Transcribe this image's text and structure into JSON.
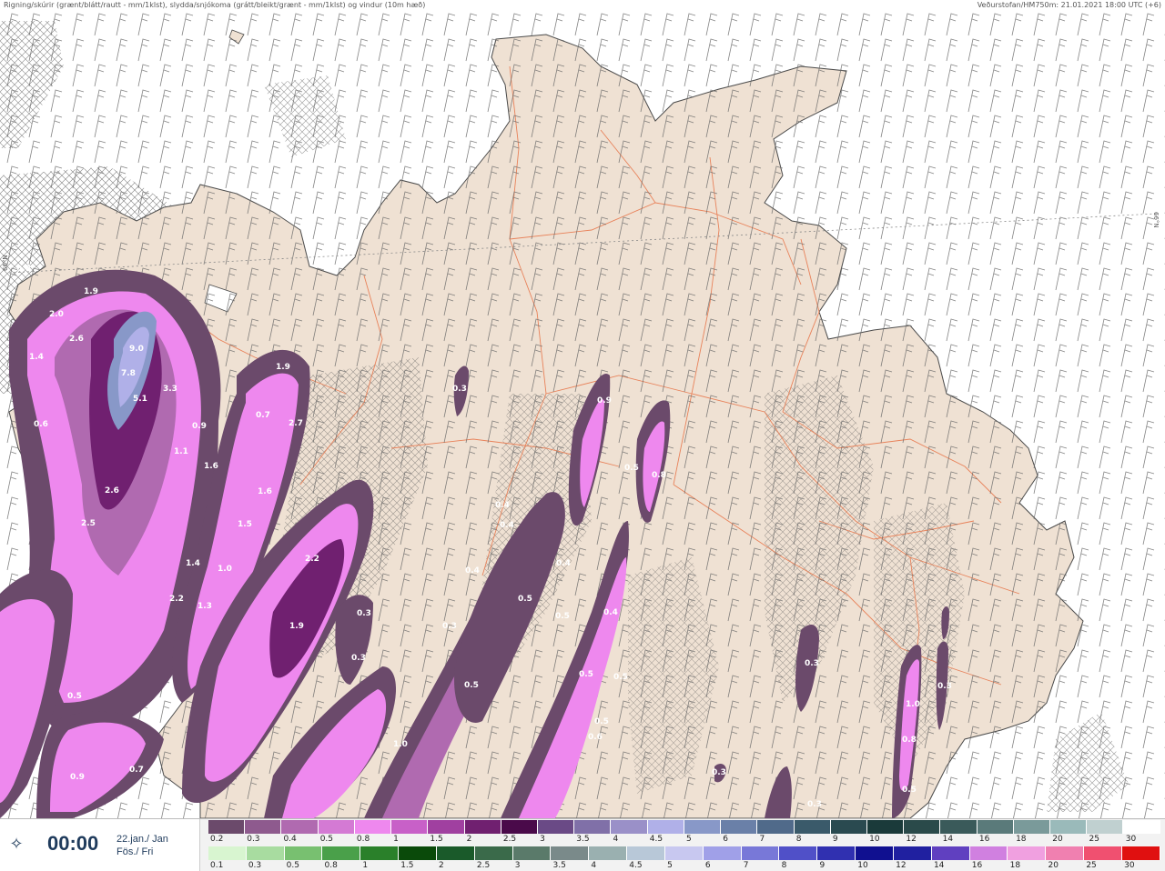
{
  "header": {
    "title": "Rigning/skúrir (grænt/blátt/rautt - mm/1klst), slydda/snjókoma (grátt/bleikt/grænt - mm/1klst) og vindur (10m hæð)",
    "model_info": "Veðurstofan/HM750m: 21.01.2021 18:00 UTC (+6)"
  },
  "map": {
    "land_color": "#efe1d3",
    "sea_color": "#ffffff",
    "road_color": "#e8825a",
    "coast_color": "#4a4a4a",
    "lat_label": "66°N",
    "values": [
      {
        "v": "0.8"
      },
      {
        "v": "1.9"
      },
      {
        "v": "2.0"
      },
      {
        "v": "2.6"
      },
      {
        "v": "1.4"
      },
      {
        "v": "9.0"
      },
      {
        "v": "7.8"
      },
      {
        "v": "5.1"
      },
      {
        "v": "3.3"
      },
      {
        "v": "0.6"
      },
      {
        "v": "0.9"
      },
      {
        "v": "1.1"
      },
      {
        "v": "1.6"
      },
      {
        "v": "2.6"
      },
      {
        "v": "2.5"
      },
      {
        "v": "1.9"
      },
      {
        "v": "0.7"
      },
      {
        "v": "2.7"
      },
      {
        "v": "1.6"
      },
      {
        "v": "1.5"
      },
      {
        "v": "1.4"
      },
      {
        "v": "1.0"
      },
      {
        "v": "2.2"
      },
      {
        "v": "1.3"
      },
      {
        "v": "2.2"
      },
      {
        "v": "1.9"
      },
      {
        "v": "0.3"
      },
      {
        "v": "0.3"
      },
      {
        "v": "0.5"
      },
      {
        "v": "0.7"
      },
      {
        "v": "0.9"
      },
      {
        "v": "0.3"
      },
      {
        "v": "0.9"
      },
      {
        "v": "0.5"
      },
      {
        "v": "0.8"
      },
      {
        "v": "0.4"
      },
      {
        "v": "0.4"
      },
      {
        "v": "0.4"
      },
      {
        "v": "0.4"
      },
      {
        "v": "0.5"
      },
      {
        "v": "0.3"
      },
      {
        "v": "0.5"
      },
      {
        "v": "0.4"
      },
      {
        "v": "0.5"
      },
      {
        "v": "0.5"
      },
      {
        "v": "0.5"
      },
      {
        "v": "0.5"
      },
      {
        "v": "1.0"
      },
      {
        "v": "0.3"
      },
      {
        "v": "0.3"
      },
      {
        "v": "0.3"
      },
      {
        "v": "0.3"
      },
      {
        "v": "1.0"
      },
      {
        "v": "0.8"
      },
      {
        "v": "0.5"
      },
      {
        "v": "0.6"
      }
    ]
  },
  "footer": {
    "logo_icon": "vedur-logo-icon",
    "time": "00:00",
    "date_line1": "22.jan./ Jan",
    "date_line2": "Fös./ Fri"
  },
  "scale_snow": {
    "labels": [
      "0.2",
      "0.3",
      "0.4",
      "0.5",
      "0.8",
      "1",
      "1.5",
      "2",
      "2.5",
      "3",
      "3.5",
      "4",
      "4.5",
      "5",
      "6",
      "7",
      "8",
      "9",
      "10",
      "12",
      "14",
      "16",
      "18",
      "20",
      "25",
      "30"
    ],
    "colors": [
      "#6b4a6b",
      "#8e5a8e",
      "#b06ab0",
      "#d47ad4",
      "#ee88ee",
      "#c860c8",
      "#a040a0",
      "#702070",
      "#4a0a4a",
      "#6a4a86",
      "#8070a8",
      "#9a90c8",
      "#b0b0e8",
      "#8898c8",
      "#6a80a8",
      "#506a8a",
      "#3a5a6a",
      "#2a4a50",
      "#1a3a3a",
      "#2a4a4a",
      "#3a5a5a",
      "#5a7a7a",
      "#7a9a9a",
      "#9ababa",
      "#c0d0d0",
      "#ffffff"
    ]
  },
  "scale_rain": {
    "labels": [
      "0.1",
      "0.3",
      "0.5",
      "0.8",
      "1",
      "1.5",
      "2",
      "2.5",
      "3",
      "3.5",
      "4",
      "4.5",
      "5",
      "6",
      "7",
      "8",
      "9",
      "10",
      "12",
      "14",
      "16",
      "18",
      "20",
      "25",
      "30"
    ],
    "colors": [
      "#d8f5d0",
      "#a8dca0",
      "#78c070",
      "#4aa04a",
      "#2a802a",
      "#0a4a0a",
      "#1a5a2a",
      "#3a6a4a",
      "#5a7a6a",
      "#7a8a8a",
      "#9ab0b0",
      "#b8c8d8",
      "#c8c8f0",
      "#a0a0e8",
      "#7878d8",
      "#5050c8",
      "#3030b0",
      "#101090",
      "#2020a0",
      "#6040c0",
      "#d080e0",
      "#f0a0e0",
      "#f080b0",
      "#f05070",
      "#e01010"
    ]
  }
}
